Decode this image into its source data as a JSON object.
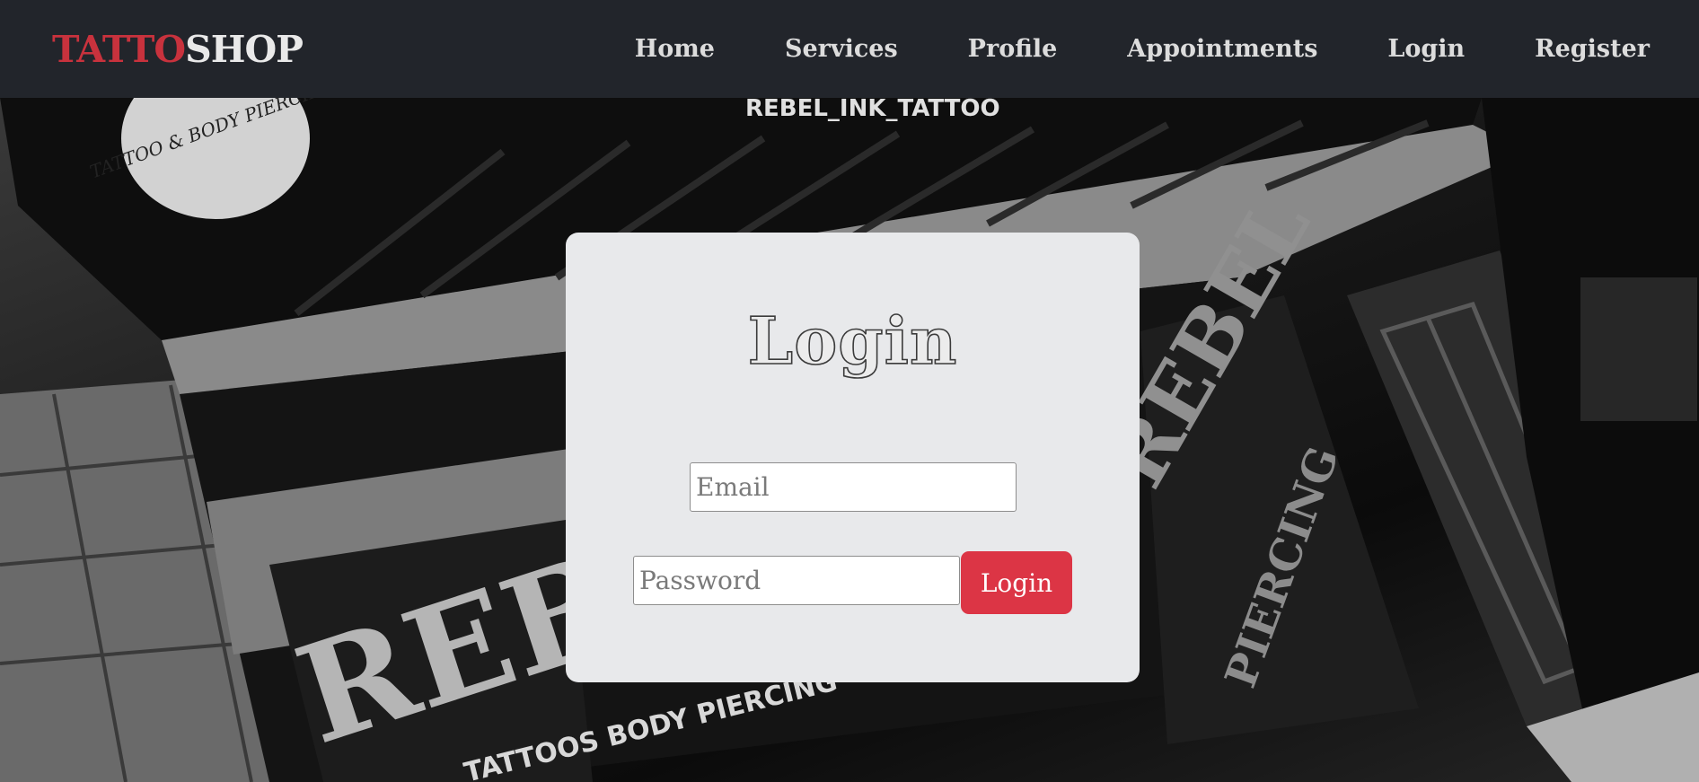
{
  "brand": {
    "part1": "TATTO",
    "part2": "SHOP",
    "color1": "#c8323d",
    "color2": "#e9e9e9"
  },
  "nav": {
    "items": [
      {
        "label": "Home"
      },
      {
        "label": "Services"
      },
      {
        "label": "Profile"
      },
      {
        "label": "Appointments"
      },
      {
        "label": "Login"
      },
      {
        "label": "Register"
      }
    ]
  },
  "hero": {
    "signs": {
      "rebel": "REBEL",
      "handle": "REBEL_INK_TATTOO",
      "piercing_round": "TATTOO & BODY PIERCING",
      "tattoos_body_piercing": "TATTOOS BODY PIERCING",
      "piercing": "PIERCING"
    }
  },
  "login_form": {
    "title": "Login",
    "email_placeholder": "Email",
    "password_placeholder": "Password",
    "submit_label": "Login",
    "button_color": "#dc3545"
  }
}
